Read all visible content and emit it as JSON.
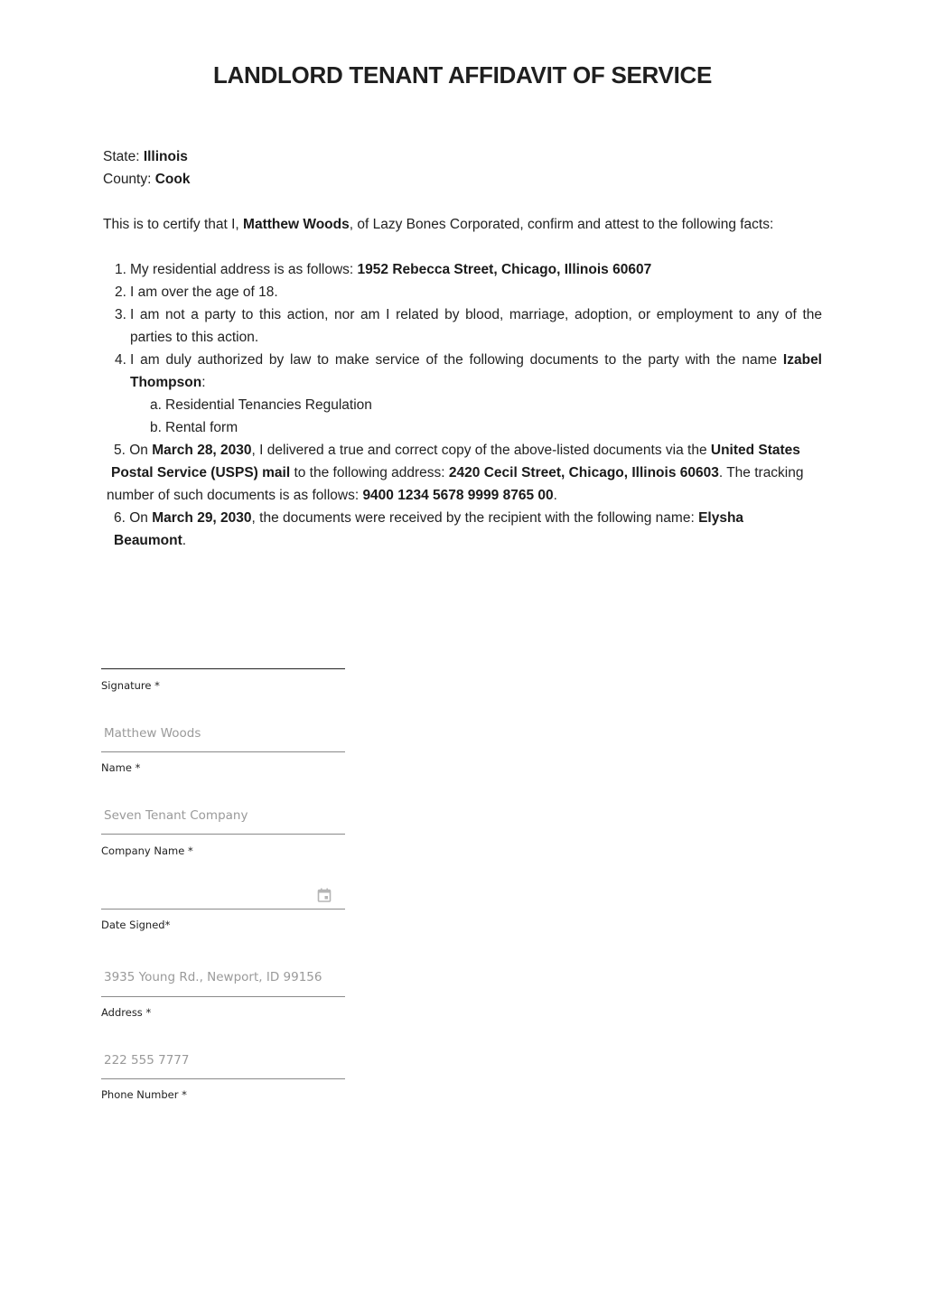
{
  "document": {
    "title": "LANDLORD TENANT AFFIDAVIT OF SERVICE",
    "state_label": "State: ",
    "state_value": "Illinois",
    "county_label": "County: ",
    "county_value": "Cook",
    "intro": {
      "pre": "This is to certify that I, ",
      "name": "Matthew Woods",
      "post": ", of Lazy Bones Corporated, confirm and attest to the following facts:"
    },
    "items": [
      {
        "num": "1.",
        "pre": "My residential address is as follows: ",
        "address": "1952 Rebecca Street, Chicago, Illinois 60607"
      },
      {
        "num": "2.",
        "text": "I am over the age of 18."
      },
      {
        "num": "3.",
        "line1": "I am not a party to this action, nor am I related by blood, marriage, adoption, or employment to any of the",
        "line2": "parties to this action."
      },
      {
        "num": "4.",
        "pre": "I am duly authorized by law to make service of the following documents to the party with the name ",
        "name_part1": "Izabel",
        "name_part2": "Thompson",
        "post": ":",
        "subitems": [
          {
            "num": "a.",
            "text": "Residential Tenancies Regulation"
          },
          {
            "num": "b.",
            "text": "Rental form"
          }
        ]
      },
      {
        "num": "5.",
        "on": "On ",
        "date": "March 28, 2030",
        "mid1": ", I delivered a true and correct copy of the above-listed documents via the ",
        "method_part1": "United States",
        "method_part2": "Postal Service (USPS) mail",
        "mid2": " to the following address: ",
        "address": "2420 Cecil Street, Chicago, Illinois 60603",
        "mid3": ". The tracking",
        "mid4": "number of such documents is as follows: ",
        "tracking": "9400 1234 5678 9999 8765 00",
        "end": "."
      },
      {
        "num": "6.",
        "on": "On ",
        "date": "March 29, 2030",
        "mid": ", the documents were received by the recipient with the following name: ",
        "name_part1": "Elysha",
        "name_part2": "Beaumont",
        "end": "."
      }
    ]
  },
  "form": {
    "fields": [
      {
        "label": "Signature *",
        "value": ""
      },
      {
        "label": "Name *",
        "value": "Matthew Woods"
      },
      {
        "label": "Company Name *",
        "value": "Seven Tenant Company"
      },
      {
        "label": "Date Signed*",
        "value": "",
        "icon": "calendar-icon"
      },
      {
        "label": "Address *",
        "value": "3935 Young Rd., Newport, ID 99156"
      },
      {
        "label": "Phone Number *",
        "value": "222 555 7777"
      }
    ]
  }
}
